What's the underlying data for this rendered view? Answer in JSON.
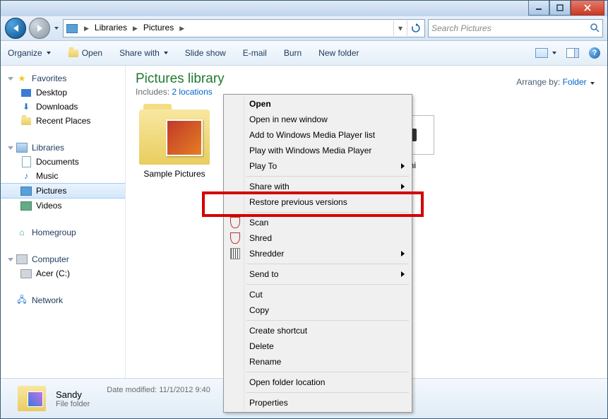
{
  "titlebar": {
    "minimize": "–",
    "maximize": "▢",
    "close": "✕"
  },
  "nav": {
    "breadcrumbs": [
      "Libraries",
      "Pictures"
    ],
    "refresh": "↻",
    "dropdown": "▾"
  },
  "search": {
    "placeholder": "Search Pictures"
  },
  "toolbar": {
    "organize": "Organize",
    "open": "Open",
    "share": "Share with",
    "slideshow": "Slide show",
    "email": "E-mail",
    "burn": "Burn",
    "newfolder": "New folder",
    "help": "?"
  },
  "sidebar": {
    "favorites": {
      "label": "Favorites",
      "items": [
        "Desktop",
        "Downloads",
        "Recent Places"
      ]
    },
    "libraries": {
      "label": "Libraries",
      "items": [
        "Documents",
        "Music",
        "Pictures",
        "Videos"
      ],
      "selected": "Pictures"
    },
    "homegroup": "Homegroup",
    "computer": {
      "label": "Computer",
      "items": [
        "Acer (C:)"
      ]
    },
    "network": "Network"
  },
  "library": {
    "title": "Pictures library",
    "includes_label": "Includes:",
    "includes_link": "2 locations",
    "arrange_label": "Arrange by:",
    "arrange_value": "Folder"
  },
  "items": {
    "sample": "Sample Pictures",
    "hidden": "ini"
  },
  "context": {
    "open": "Open",
    "open_new": "Open in new window",
    "add_wmp_list": "Add to Windows Media Player list",
    "play_wmp": "Play with Windows Media Player",
    "play_to": "Play To",
    "share_with": "Share with",
    "restore": "Restore previous versions",
    "scan": "Scan",
    "shred": "Shred",
    "shredder": "Shredder",
    "send_to": "Send to",
    "cut": "Cut",
    "copy": "Copy",
    "create_shortcut": "Create shortcut",
    "delete": "Delete",
    "rename": "Rename",
    "open_loc": "Open folder location",
    "properties": "Properties"
  },
  "details": {
    "name": "Sandy",
    "type": "File folder",
    "meta_label": "Date modified:",
    "meta_value": "11/1/2012 9:40"
  }
}
